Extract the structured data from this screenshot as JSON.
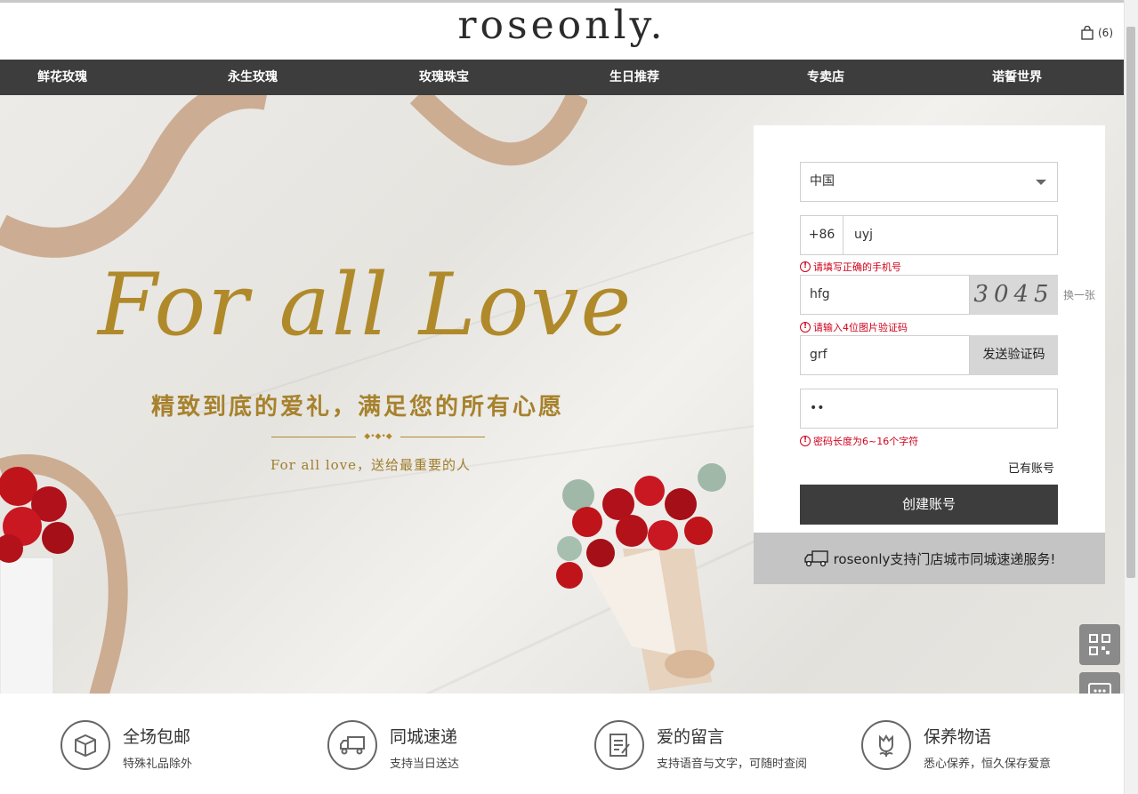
{
  "header": {
    "logo": "roseonly.",
    "cart_count": "(6)"
  },
  "nav": {
    "items": [
      "鲜花玫瑰",
      "永生玫瑰",
      "玫瑰珠宝",
      "生日推荐",
      "专卖店",
      "诺誓世界"
    ]
  },
  "hero": {
    "script_title": "For all Love",
    "subtitle": "精致到底的爱礼，满足您的所有心愿",
    "tagline": "For all love，送给最重要的人"
  },
  "register": {
    "country": "中国",
    "phone_prefix": "+86",
    "phone_value": "uyj",
    "phone_error": "请填写正确的手机号",
    "captcha_value": "hfg",
    "captcha_image_text": "3045",
    "refresh_captcha": "换一张",
    "captcha_error": "请输入4位图片验证码",
    "sms_code_value": "grf",
    "send_code_button": "发送验证码",
    "password_value": "••",
    "password_error": "密码长度为6~16个字符",
    "have_account_link": "已有账号",
    "create_button": "创建账号",
    "delivery_notice": "roseonly支持门店城市同城速递服务!"
  },
  "features": [
    {
      "title": "全场包邮",
      "desc": "特殊礼品除外",
      "icon": "box-icon"
    },
    {
      "title": "同城速递",
      "desc": "支持当日送达",
      "icon": "delivery-truck-icon"
    },
    {
      "title": "爱的留言",
      "desc": "支持语音与文字，可随时查阅",
      "icon": "note-icon"
    },
    {
      "title": "保养物语",
      "desc": "悉心保养，恒久保存爱意",
      "icon": "flower-icon"
    }
  ],
  "colors": {
    "nav_bg": "#3d3d3d",
    "gold": "#b08a2a",
    "error": "#d0021b"
  }
}
